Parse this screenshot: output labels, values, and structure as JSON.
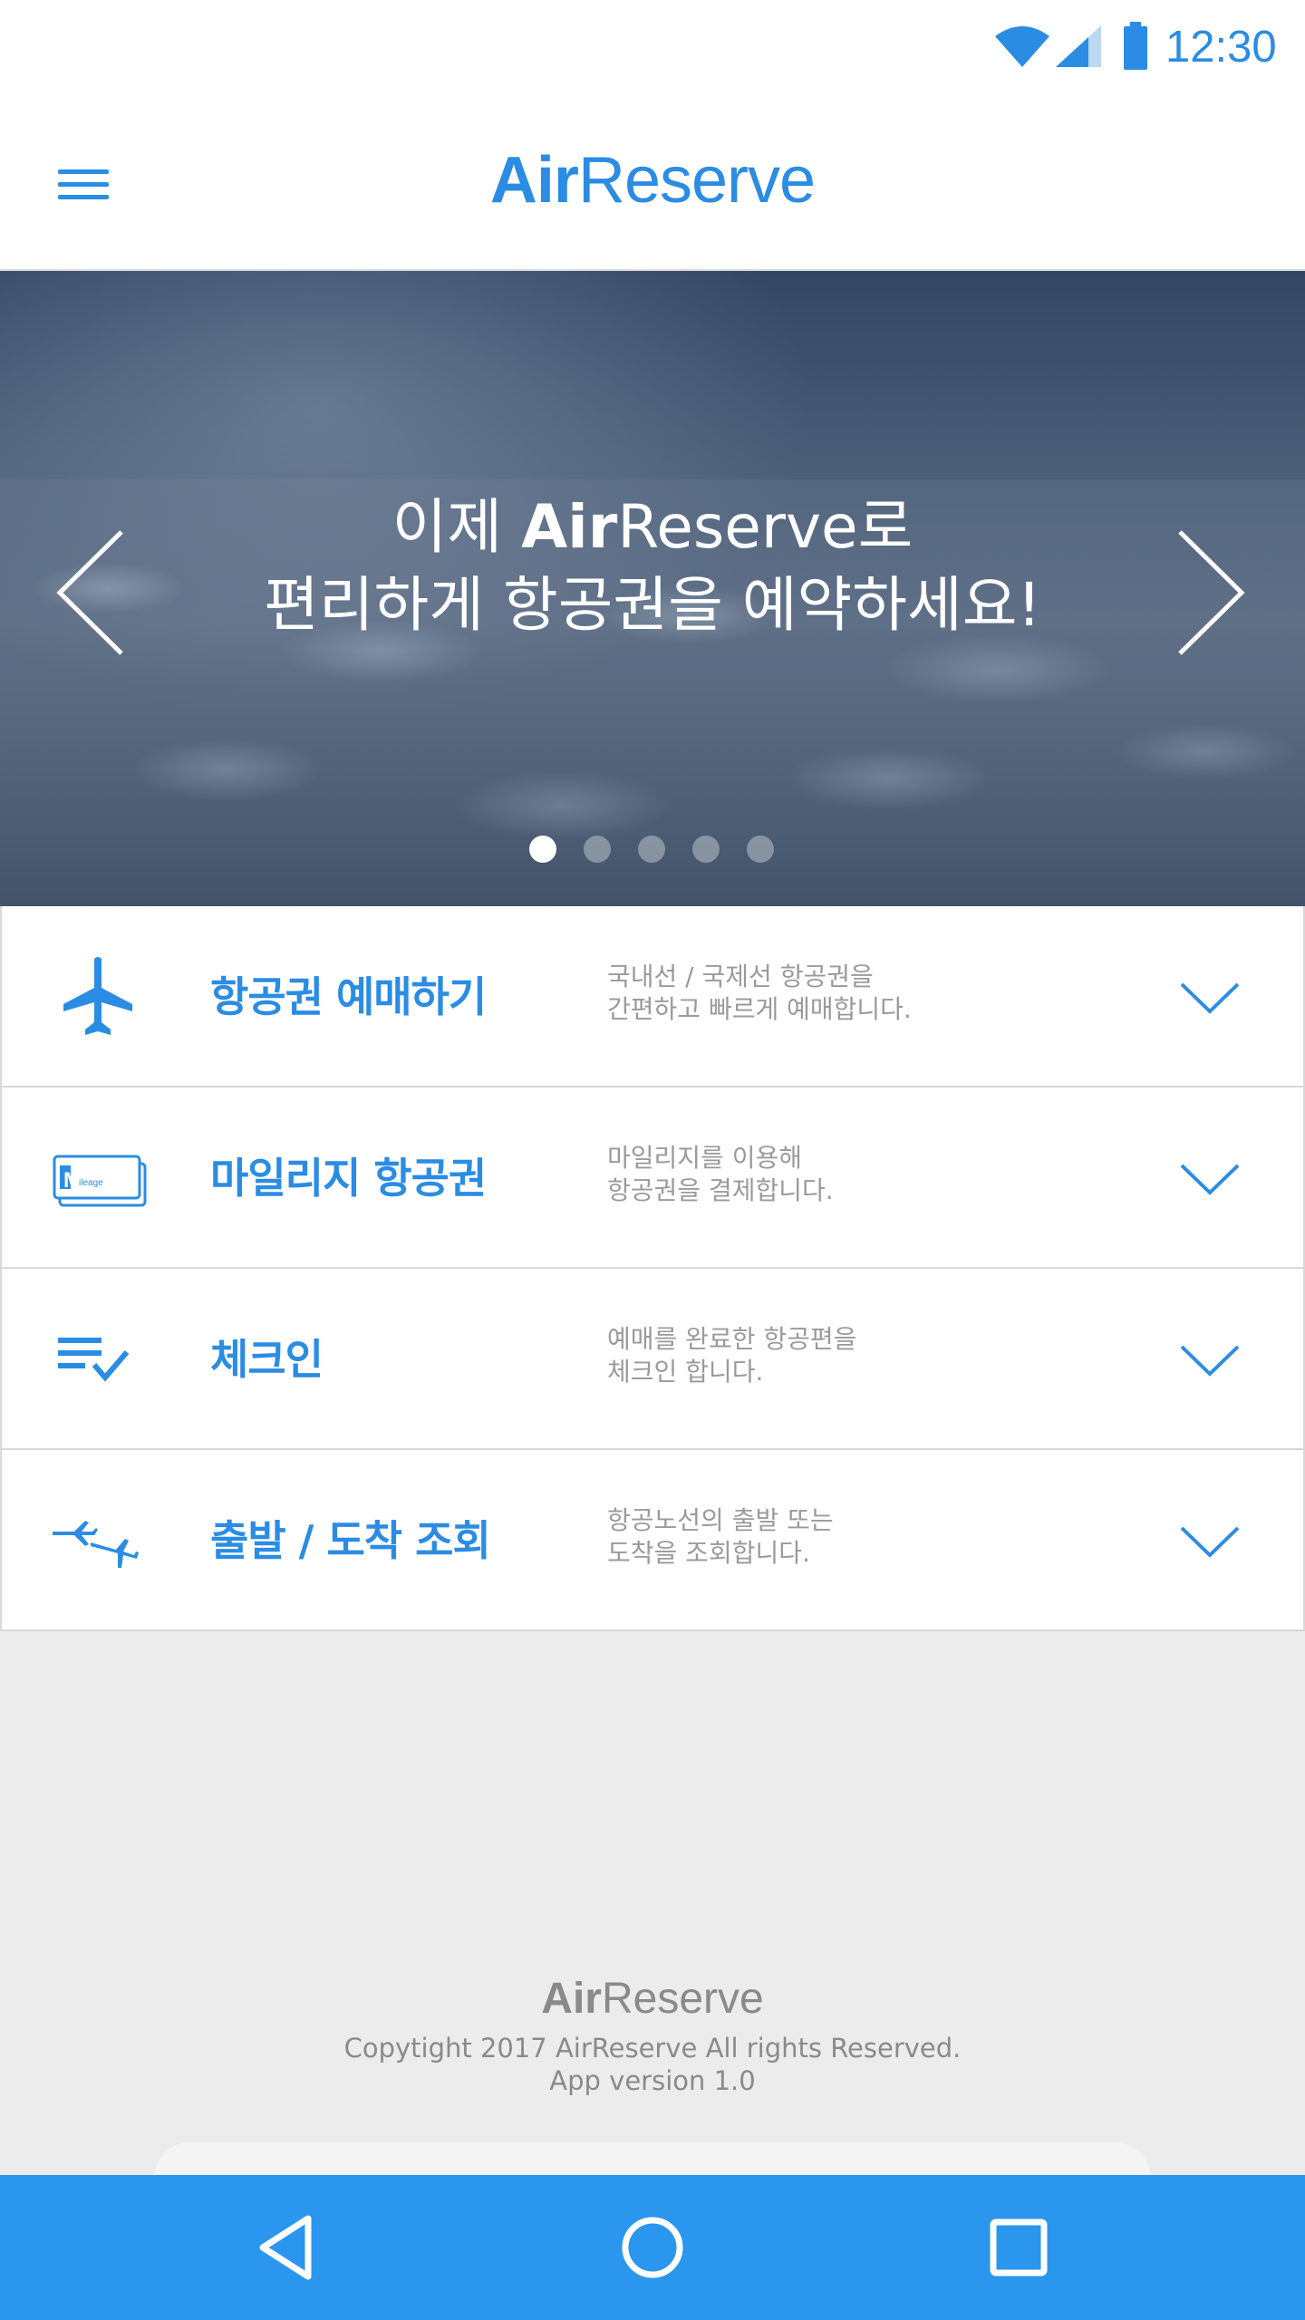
{
  "status_bar": {
    "time": "12:30",
    "icons": [
      "wifi-icon",
      "cell-signal-icon",
      "battery-icon"
    ],
    "accent_color": "#2b8ce3"
  },
  "app_bar": {
    "menu_icon": "hamburger-menu-icon",
    "brand_part1": "Air",
    "brand_part2": "Reserve",
    "brand_color": "#2b8ce3"
  },
  "hero": {
    "line1_prefix": "이제 ",
    "line1_bold": "Air",
    "line1_brand_rest": "Reserve",
    "line1_suffix": "로",
    "line2": "편리하게 항공권을 예약하세요!",
    "prev_icon": "chevron-left-icon",
    "next_icon": "chevron-right-icon",
    "slide_count": 5,
    "active_slide": 1
  },
  "menu": {
    "items": [
      {
        "icon": "airplane-icon",
        "title": "항공권 예매하기",
        "desc_line1": "국내선 / 국제선 항공권을",
        "desc_line2": "간편하고 빠르게 예매합니다."
      },
      {
        "icon": "mileage-card-icon",
        "icon_label": "M",
        "icon_sublabel": "ileage",
        "title": "마일리지 항공권",
        "desc_line1": "마일리지를 이용해",
        "desc_line2": "항공권을 결제합니다."
      },
      {
        "icon": "checklist-icon",
        "title": "체크인",
        "desc_line1": "예매를 완료한 항공편을",
        "desc_line2": "체크인 합니다."
      },
      {
        "icon": "takeoff-landing-icon",
        "title": "출발 / 도착 조회",
        "desc_line1": "항공노선의 출발 또는",
        "desc_line2": "도착을 조회합니다."
      }
    ],
    "expand_icon": "chevron-down-icon"
  },
  "footer": {
    "brand_part1": "Air",
    "brand_part2": "Reserve",
    "copyright": "Copytight 2017 AirReserve All rights Reserved.",
    "version": "App version 1.0"
  },
  "nav_bar": {
    "color": "#2b96ee",
    "buttons": [
      "back-icon",
      "home-icon",
      "recent-apps-icon"
    ]
  }
}
